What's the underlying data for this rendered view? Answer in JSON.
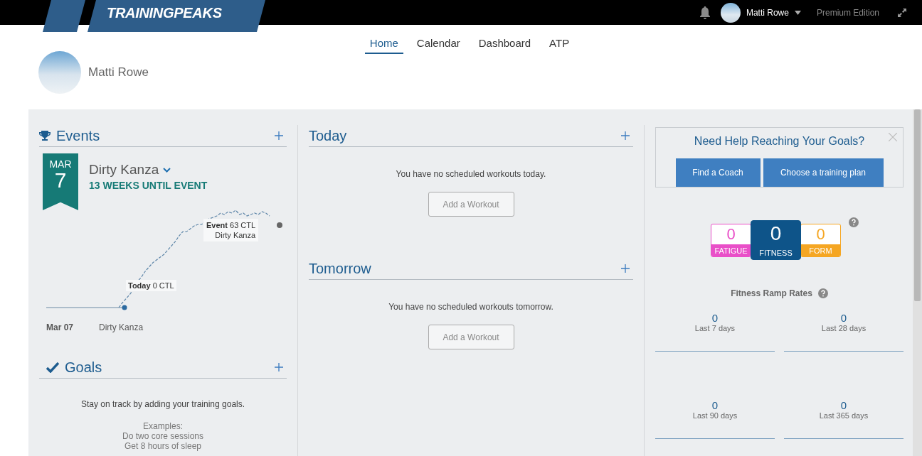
{
  "top_bar": {
    "logo": "TRAININGPEAKS",
    "user_name": "Matti Rowe",
    "edition": "Premium Edition"
  },
  "nav_tabs": [
    {
      "label": "Home",
      "selected": true
    },
    {
      "label": "Calendar",
      "selected": false
    },
    {
      "label": "Dashboard",
      "selected": false
    },
    {
      "label": "ATP",
      "selected": false
    }
  ],
  "profile": {
    "name": "Matti Rowe"
  },
  "events": {
    "title": "Events",
    "month": "MAR",
    "day": "7",
    "event_name": "Dirty Kanza",
    "countdown": "13 WEEKS UNTIL EVENT",
    "today_label": "**Today** 0 CTL",
    "event_label": "**Event** 63 CTL",
    "event_label_name": "Dirty Kanza",
    "list": [
      {
        "date": "Mar 07",
        "name": "Dirty Kanza"
      }
    ]
  },
  "today": {
    "title": "Today",
    "message": "You have no scheduled workouts today.",
    "button": "Add a Workout"
  },
  "tomorrow": {
    "title": "Tomorrow",
    "message": "You have no scheduled workouts tomorrow.",
    "button": "Add a Workout"
  },
  "goals": {
    "title": "Goals",
    "message": "Stay on track by adding your training goals.",
    "examples": [
      "Examples:",
      "Do two core sessions",
      "Get 8 hours of sleep"
    ]
  },
  "promo": {
    "title": "Need Help Reaching Your Goals?",
    "buttons": [
      "Find a Coach",
      "Choose a training plan"
    ]
  },
  "metrics": [
    {
      "kind": "side",
      "value": "0",
      "label": "FATIGUE",
      "color": "#e94fc8"
    },
    {
      "kind": "center",
      "value": "0",
      "label": "FITNESS",
      "color": "#0e5489"
    },
    {
      "kind": "side",
      "value": "0",
      "label": "FORM",
      "color": "#f5a623"
    }
  ],
  "ramp_title": "Fitness Ramp Rates",
  "ramp_rates": [
    {
      "value": "0",
      "label": "Last 7 days"
    },
    {
      "value": "0",
      "label": "Last 28 days"
    },
    {
      "value": "0",
      "label": "Last 90 days"
    },
    {
      "value": "0",
      "label": "Last 365 days"
    }
  ]
}
